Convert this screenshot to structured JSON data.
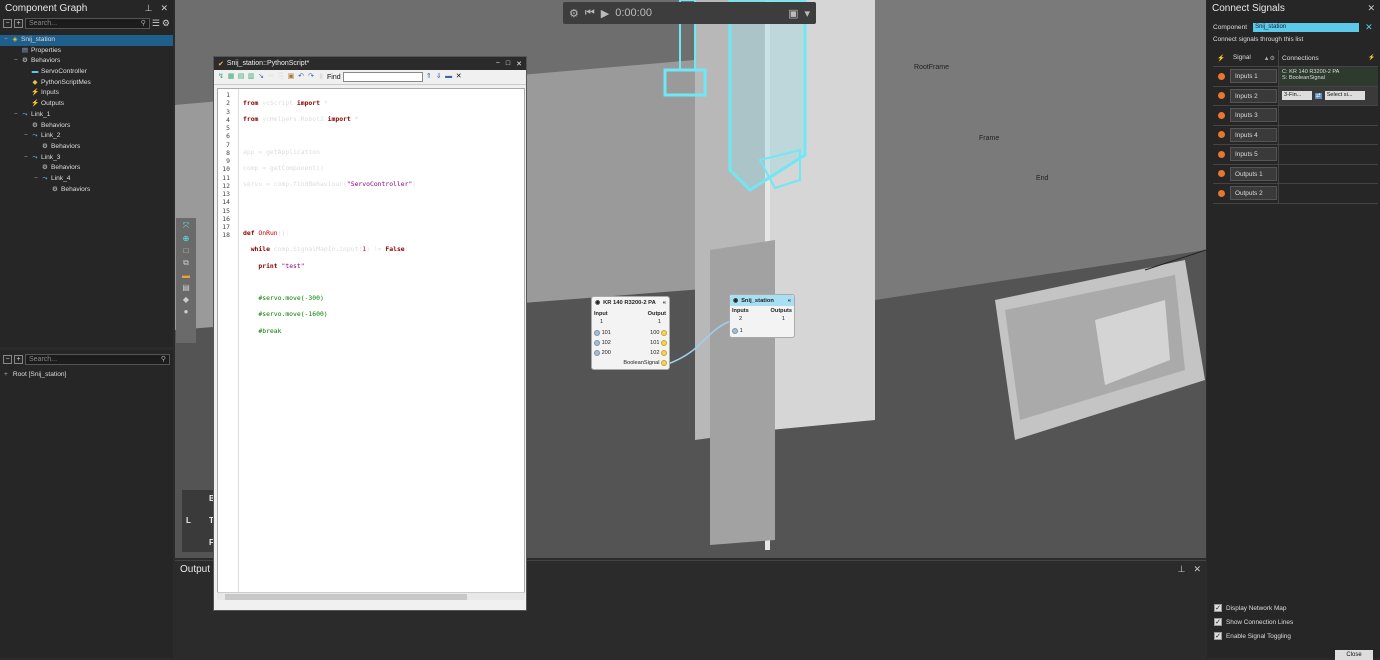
{
  "component_graph": {
    "title": "Component Graph",
    "search_placeholder": "Search...",
    "tree": [
      {
        "label": "Snij_station",
        "depth": 0,
        "icon": "component-icon",
        "selected": true
      },
      {
        "label": "Properties",
        "depth": 1,
        "icon": "properties-icon"
      },
      {
        "label": "Behaviors",
        "depth": 1,
        "icon": "gear-icon"
      },
      {
        "label": "ServoController",
        "depth": 2,
        "icon": "servo-icon"
      },
      {
        "label": "PythonScriptMes",
        "depth": 2,
        "icon": "python-icon"
      },
      {
        "label": "Inputs",
        "depth": 2,
        "icon": "signal-icon"
      },
      {
        "label": "Outputs",
        "depth": 2,
        "icon": "signal-icon"
      },
      {
        "label": "Link_1",
        "depth": 1,
        "icon": "link-icon"
      },
      {
        "label": "Behaviors",
        "depth": 2,
        "icon": "gear-icon"
      },
      {
        "label": "Link_2",
        "depth": 2,
        "icon": "link-icon"
      },
      {
        "label": "Behaviors",
        "depth": 3,
        "icon": "gear-icon"
      },
      {
        "label": "Link_3",
        "depth": 2,
        "icon": "link-icon"
      },
      {
        "label": "Behaviors",
        "depth": 3,
        "icon": "gear-icon"
      },
      {
        "label": "Link_4",
        "depth": 3,
        "icon": "link-icon"
      },
      {
        "label": "Behaviors",
        "depth": 4,
        "icon": "gear-icon"
      }
    ]
  },
  "cell_graph": {
    "search_placeholder": "Search...",
    "root_label": "Root [Snij_station]"
  },
  "timeline": {
    "time": "0:00:00"
  },
  "viewport": {
    "labels": [
      "RootFrame",
      "Frame",
      "End"
    ],
    "viewcube": {
      "left": "L",
      "top": "T",
      "back": "B",
      "front": "F"
    }
  },
  "output_panel": {
    "title": "Output"
  },
  "python_window": {
    "title": "Snij_station::PythonScript*",
    "find_label": "Find",
    "line_numbers": [
      "1",
      "2",
      "3",
      "4",
      "5",
      "6",
      "7",
      "8",
      "9",
      "10",
      "11",
      "12",
      "13",
      "14",
      "15",
      "16",
      "17",
      "18"
    ]
  },
  "node_robot": {
    "title": "KR 140 R3200-2 PA",
    "input_label": "Input",
    "output_label": "Output",
    "input_bus": "1",
    "output_bus": "1",
    "inputs": [
      "101",
      "102",
      "200"
    ],
    "outputs": [
      "100",
      "101",
      "102",
      "BooleanSignal"
    ]
  },
  "node_station": {
    "title": "Snij_station",
    "inputs_label": "Inputs",
    "outputs_label": "Outputs",
    "input_bus": "2",
    "output_bus": "1",
    "inputs": [
      "1"
    ]
  },
  "connect_signals": {
    "title": "Connect Signals",
    "component_label": "Component",
    "component_value": "Snij_station",
    "hint": "Connect signals through this list",
    "col_signal": "Signal",
    "col_connections": "Connections",
    "signals": [
      "Inputs 1",
      "Inputs 2",
      "Inputs 3",
      "Inputs 4",
      "Inputs 5",
      "Outputs 1",
      "Outputs 2"
    ],
    "inputs1_connection_line1": "C: KR 140 R3200-2 PA",
    "inputs1_connection_line2": "S: BooleanSignal",
    "inputs2_select1": "3-Fin...",
    "inputs2_select2": "Select si...",
    "checkboxes": [
      "Display Network Map",
      "Show Connection Lines",
      "Enable Signal Toggling"
    ],
    "close_label": "Close"
  },
  "colors": {
    "accent": "#5cc9e8",
    "signal_dot": "#e8772e",
    "selection": "#1f5f8c"
  }
}
